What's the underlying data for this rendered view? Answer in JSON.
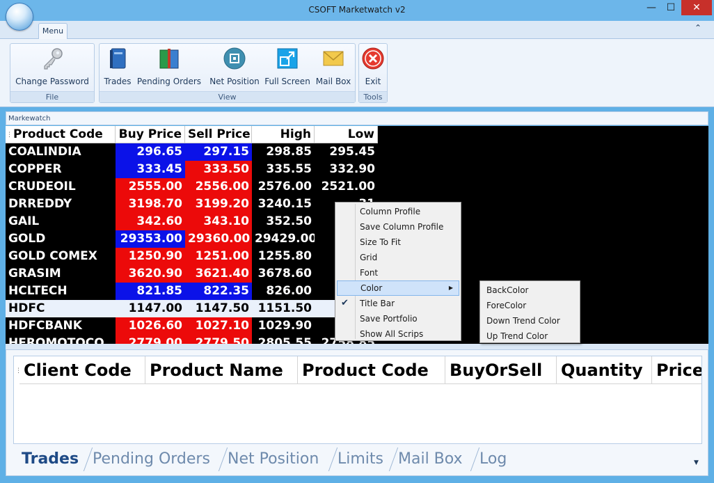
{
  "window": {
    "title": "CSOFT Marketwatch v2",
    "minimize": "—",
    "maximize": "☐",
    "close": "✕"
  },
  "menu_tab": "Menu",
  "collapse_glyph": "⌃",
  "ribbon": {
    "groups": [
      {
        "label": "File",
        "buttons": [
          {
            "label": "Change Password",
            "icon": "key-icon"
          }
        ]
      },
      {
        "label": "View",
        "buttons": [
          {
            "label": "Trades",
            "icon": "blue-book-icon"
          },
          {
            "label": "Pending Orders",
            "icon": "green-book-icon"
          },
          {
            "label": "Net Position",
            "icon": "net-position-icon"
          },
          {
            "label": "Full Screen",
            "icon": "full-screen-icon"
          },
          {
            "label": "Mail Box",
            "icon": "envelope-icon"
          }
        ]
      },
      {
        "label": "Tools",
        "buttons": [
          {
            "label": "Exit",
            "icon": "exit-icon"
          }
        ]
      }
    ]
  },
  "marketwatch": {
    "header": "Markewatch",
    "columns": [
      "Product Code",
      "Buy Price",
      "Sell Price",
      "High",
      "Low"
    ],
    "rows": [
      {
        "code": "COALINDIA",
        "buy": "296.65",
        "sell": "297.15",
        "high": "298.85",
        "low": "295.45",
        "buy_color": "blue",
        "sell_color": "blue"
      },
      {
        "code": "COPPER",
        "buy": "333.45",
        "sell": "333.50",
        "high": "335.55",
        "low": "332.90",
        "buy_color": "blue",
        "sell_color": "red"
      },
      {
        "code": "CRUDEOIL",
        "buy": "2555.00",
        "sell": "2556.00",
        "high": "2576.00",
        "low": "2521.00",
        "buy_color": "red",
        "sell_color": "red"
      },
      {
        "code": "DRREDDY",
        "buy": "3198.70",
        "sell": "3199.20",
        "high": "3240.15",
        "low": "31",
        "buy_color": "red",
        "sell_color": "red"
      },
      {
        "code": "GAIL",
        "buy": "342.60",
        "sell": "343.10",
        "high": "352.50",
        "low": "3",
        "buy_color": "red",
        "sell_color": "red"
      },
      {
        "code": "GOLD",
        "buy": "29353.00",
        "sell": "29360.00",
        "high": "29429.00",
        "low": "292",
        "buy_color": "blue",
        "sell_color": "red"
      },
      {
        "code": "GOLD COMEX",
        "buy": "1250.90",
        "sell": "1251.00",
        "high": "1255.80",
        "low": "12",
        "buy_color": "red",
        "sell_color": "red"
      },
      {
        "code": "GRASIM",
        "buy": "3620.90",
        "sell": "3621.40",
        "high": "3678.60",
        "low": "35",
        "buy_color": "red",
        "sell_color": "red"
      },
      {
        "code": "HCLTECH",
        "buy": "821.85",
        "sell": "822.35",
        "high": "826.00",
        "low": "8",
        "buy_color": "blue",
        "sell_color": "blue"
      },
      {
        "code": "HDFC",
        "buy": "1147.00",
        "sell": "1147.50",
        "high": "1151.50",
        "low": "11",
        "buy_color": "none",
        "sell_color": "none"
      },
      {
        "code": "HDFCBANK",
        "buy": "1026.60",
        "sell": "1027.10",
        "high": "1029.90",
        "low": "10",
        "buy_color": "red",
        "sell_color": "red"
      },
      {
        "code": "HEROMOTOCO",
        "buy": "2779.00",
        "sell": "2779.50",
        "high": "2805.55",
        "low": "2758.85",
        "buy_color": "red",
        "sell_color": "red"
      }
    ]
  },
  "context_menu": {
    "items": [
      "Column Profile",
      "Save Column Profile",
      "Size To Fit",
      "Grid",
      "Font",
      "Color",
      "Title Bar",
      "Save Portfolio",
      "Show All Scrips"
    ],
    "highlighted": "Color",
    "checked": "Title Bar",
    "submenu_arrow": "▶",
    "check_glyph": "✔"
  },
  "color_submenu": [
    "BackColor",
    "ForeColor",
    "Down Trend Color",
    "Up Trend Color"
  ],
  "trades": {
    "columns": [
      "Client Code",
      "Product Name",
      "Product Code",
      "BuyOrSell",
      "Quantity",
      "Price"
    ]
  },
  "bottom_tabs": [
    "Trades",
    "Pending Orders",
    "Net Position",
    "Limits",
    "Mail Box",
    "Log"
  ],
  "active_bottom_tab": "Trades",
  "colors": {
    "buy_blue": "#0b12e8",
    "sell_red": "#ec0a0a",
    "grid_bg": "#000000",
    "ribbon_bg": "#eef4fb",
    "titlebar": "#6cb6ea"
  }
}
